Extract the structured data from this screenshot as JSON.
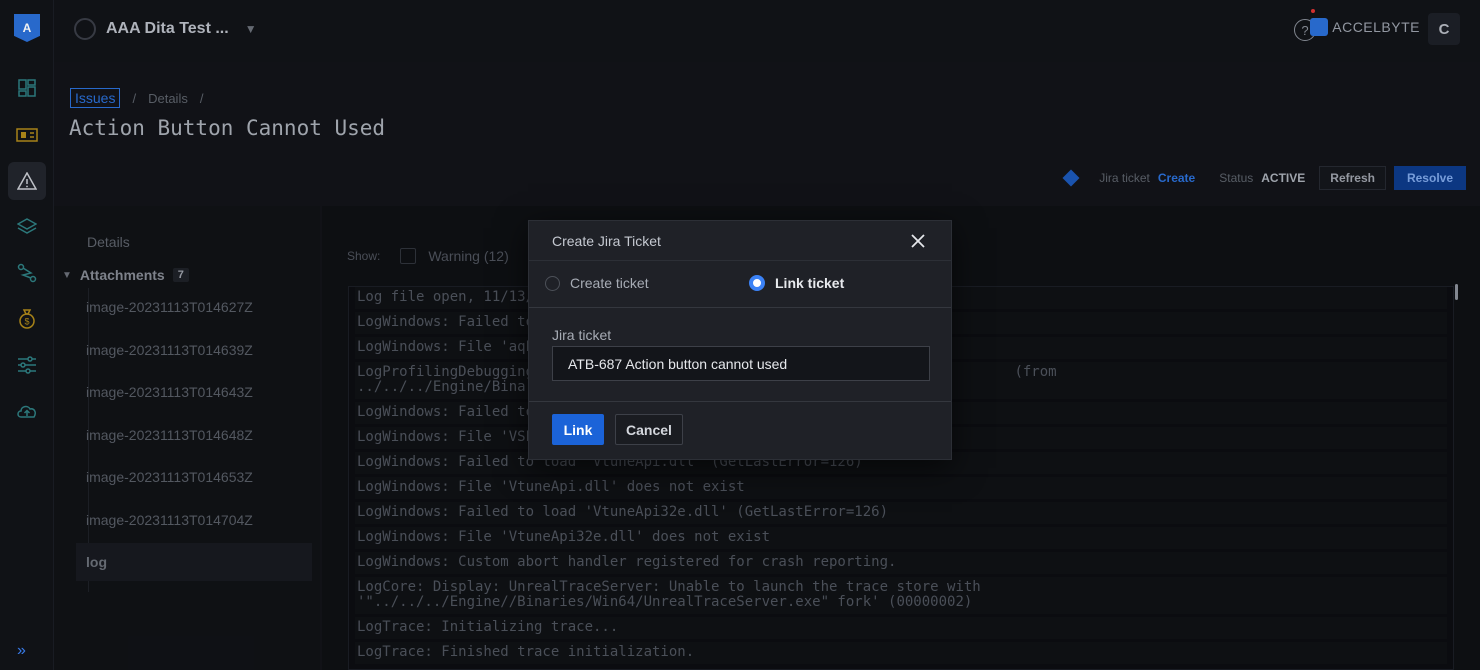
{
  "topbar": {
    "project_name": "AAA Dita Test ...",
    "brand": "ACCELBYTE",
    "avatar_letter": "C",
    "help_symbol": "?"
  },
  "rail": {
    "logo_text": "A",
    "icons": [
      "dashboard-icon",
      "game-icon",
      "alert-icon",
      "layers-icon",
      "route-icon",
      "commerce-icon",
      "sliders-icon",
      "cloud-upload-icon"
    ],
    "active_index": 2
  },
  "breadcrumb": {
    "items": [
      "Issues",
      "Details"
    ],
    "separator": "/"
  },
  "page_title": "Action Button Cannot Used",
  "actions": {
    "jira_label": "Jira ticket",
    "jira_create": "Create",
    "status_label": "Status",
    "status_value": "ACTIVE",
    "refresh": "Refresh",
    "resolve": "Resolve"
  },
  "left_panel": {
    "details": "Details",
    "attachments_label": "Attachments",
    "attachments_count": "7",
    "files": [
      "image-20231113T014627Z",
      "image-20231113T014639Z",
      "image-20231113T014643Z",
      "image-20231113T014648Z",
      "image-20231113T014653Z",
      "image-20231113T014704Z",
      "log"
    ],
    "selected_file": "log"
  },
  "log": {
    "show_label": "Show:",
    "warning_filter": "Warning (12)",
    "lines": [
      "Log file open, 11/13/",
      "LogWindows: Failed to",
      "LogWindows: File 'aqP",
      "LogProfilingDebugging                                                         (from\n../../../Engine/Binar",
      "LogWindows: Failed to",
      "LogWindows: File 'VSP",
      "LogWindows: Failed to load 'VtuneApi.dll' (GetLastError=126)",
      "LogWindows: File 'VtuneApi.dll' does not exist",
      "LogWindows: Failed to load 'VtuneApi32e.dll' (GetLastError=126)",
      "LogWindows: File 'VtuneApi32e.dll' does not exist",
      "LogWindows: Custom abort handler registered for crash reporting.",
      "LogCore: Display: UnrealTraceServer: Unable to launch the trace store with\n'\"../../../Engine//Binaries/Win64/UnrealTraceServer.exe\" fork' (00000002)",
      "LogTrace: Initializing trace...",
      "LogTrace: Finished trace initialization."
    ]
  },
  "modal": {
    "title": "Create Jira Ticket",
    "option_create": "Create ticket",
    "option_link": "Link ticket",
    "selected_option": "Link ticket",
    "field_label": "Jira ticket",
    "field_value": "ATB-687 Action button cannot used",
    "link_button": "Link",
    "cancel_button": "Cancel"
  },
  "colors": {
    "accent": "#1b63d8",
    "link": "#2b6fd6",
    "background": "#121419",
    "modal_bg": "#1f2127"
  }
}
